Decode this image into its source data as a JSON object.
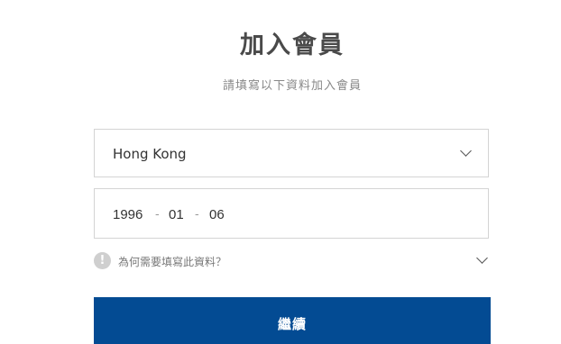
{
  "header": {
    "title": "加入會員",
    "subtitle": "請填寫以下資料加入會員"
  },
  "form": {
    "region": {
      "selected": "Hong Kong",
      "icon": "chevron-down-icon"
    },
    "birthdate": {
      "year": "1996",
      "month": "01",
      "day": "06",
      "separator": "-"
    },
    "info": {
      "icon_glyph": "!",
      "icon": "info-icon",
      "text": "為何需要填寫此資料？"
    },
    "submit_label": "繼續"
  },
  "colors": {
    "primary_button": "#034b93",
    "border": "#d4d4d4"
  }
}
